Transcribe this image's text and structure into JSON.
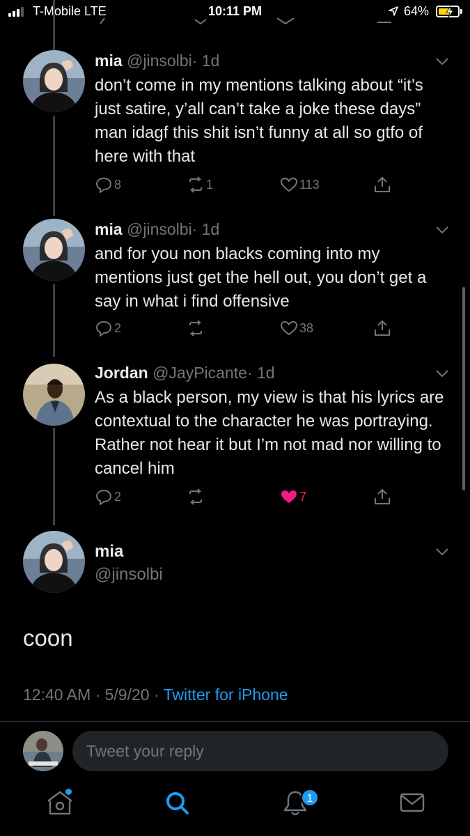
{
  "status_bar": {
    "carrier": "T-Mobile  LTE",
    "time": "10:11 PM",
    "battery": "64%",
    "signal_bars": 3,
    "battery_level": 0.64,
    "icons": [
      "signal-icon",
      "location-icon",
      "battery-icon",
      "charging-bolt-icon"
    ]
  },
  "tweets": [
    {
      "name": "mia",
      "handle": "@jinsolbi",
      "time": "· 1d",
      "text": "don’t come in my mentions talking about “it’s just satire, y’all can’t take a joke these days” man idagf this shit isn’t funny at all so gtfo of here with that",
      "replies": "8",
      "retweets": "1",
      "likes": "113",
      "liked": false
    },
    {
      "name": "mia",
      "handle": "@jinsolbi",
      "time": "· 1d",
      "text": "and for you non blacks coming into my mentions just get the hell out, you don’t get a say in what i find offensive",
      "replies": "2",
      "retweets": "",
      "likes": "38",
      "liked": false
    },
    {
      "name": "Jordan",
      "handle": "@JayPicante",
      "time": "· 1d",
      "text": "As a black person, my view is that his lyrics are contextual to the character he was portraying. Rather not hear it but I’m not mad nor willing to cancel him",
      "replies": "2",
      "retweets": "",
      "likes": "7",
      "liked": true
    }
  ],
  "focused_tweet": {
    "name": "mia",
    "handle": "@jinsolbi",
    "text": "coon",
    "timestamp": "12:40 AM · 5/9/20 · ",
    "source": "Twitter for iPhone"
  },
  "reply": {
    "placeholder": "Tweet your reply"
  },
  "tabbar": {
    "items": [
      "home-icon",
      "search-icon",
      "notifications-icon",
      "messages-icon"
    ],
    "notification_badge": "1",
    "accent": "#1d9bf0"
  },
  "colors": {
    "background": "#000000",
    "text": "#e7e9ea",
    "muted": "#71767b",
    "like": "#f91880",
    "link": "#1d9bf0"
  }
}
